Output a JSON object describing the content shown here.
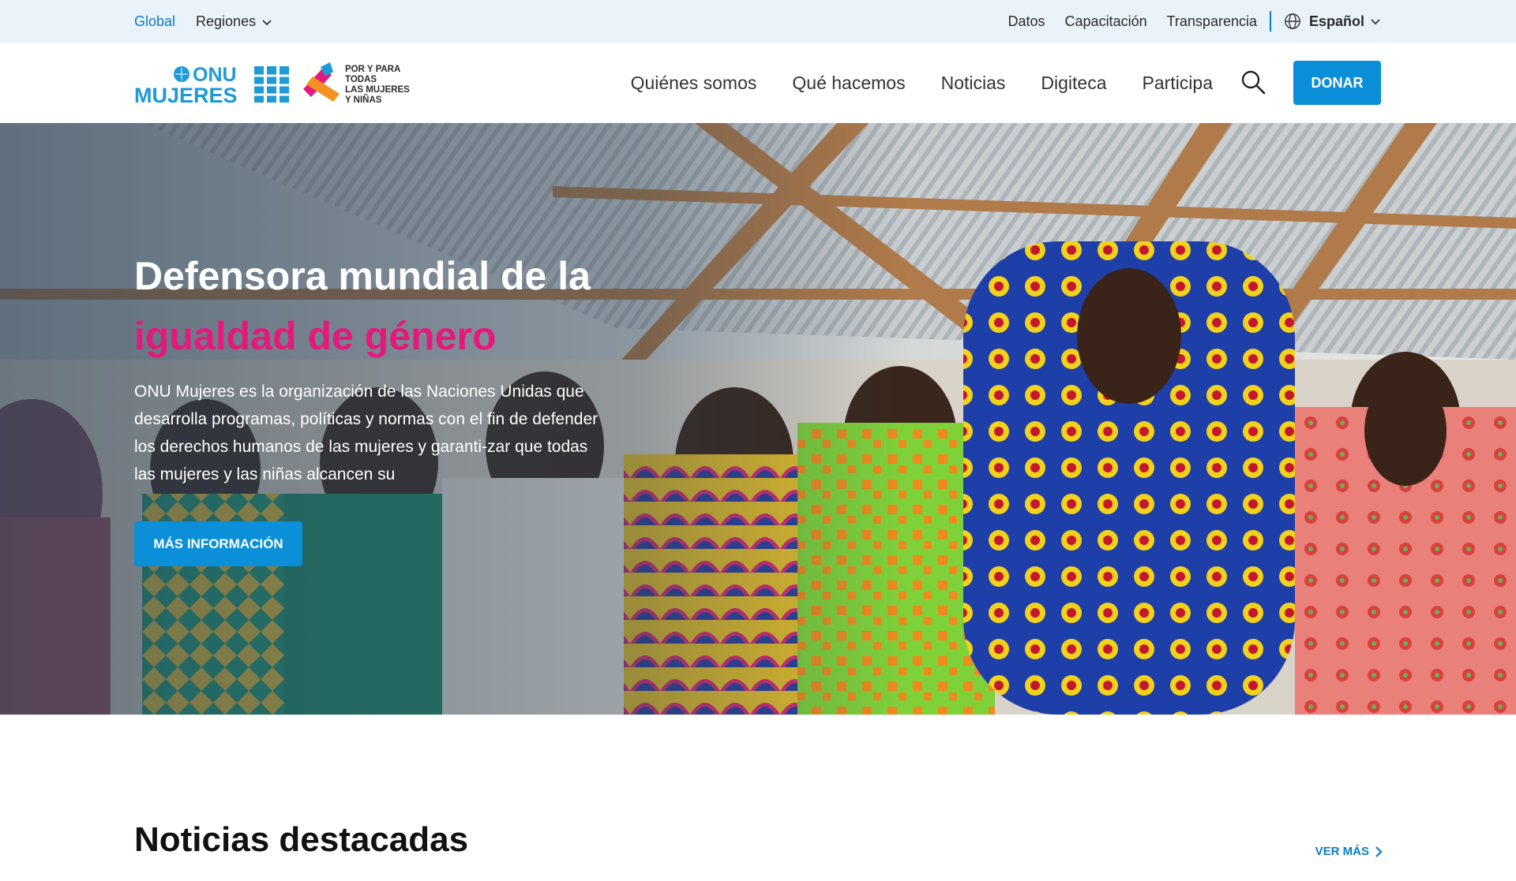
{
  "utility": {
    "global": "Global",
    "regions": "Regiones",
    "links": [
      "Datos",
      "Capacitación",
      "Transparencia"
    ],
    "language": "Español"
  },
  "header": {
    "logo_onu_line1": "ONU",
    "logo_onu_line2": "MUJERES",
    "logo_todas": [
      "POR Y PARA",
      "TODAS",
      "LAS MUJERES",
      "Y NIÑAS"
    ],
    "nav": [
      "Quiénes somos",
      "Qué hacemos",
      "Noticias",
      "Digiteca",
      "Participa"
    ],
    "donate": "DONAR"
  },
  "hero": {
    "title_line1": "Defensora mundial de la",
    "title_highlight": "igualdad de género",
    "text": "ONU Mujeres es la organización de las Naciones Unidas que desarrolla programas, políticas y normas con el fin de defender los derechos humanos de las mujeres y garanti-zar que todas las mujeres y las niñas alcancen su",
    "button": "MÁS INFORMACIÓN"
  },
  "featured": {
    "title": "Noticias destacadas",
    "see_more": "VER MÁS"
  },
  "colors": {
    "accent_blue": "#0a8fd8",
    "highlight_pink": "#e5197d",
    "utility_bg": "#eaf2fa"
  }
}
